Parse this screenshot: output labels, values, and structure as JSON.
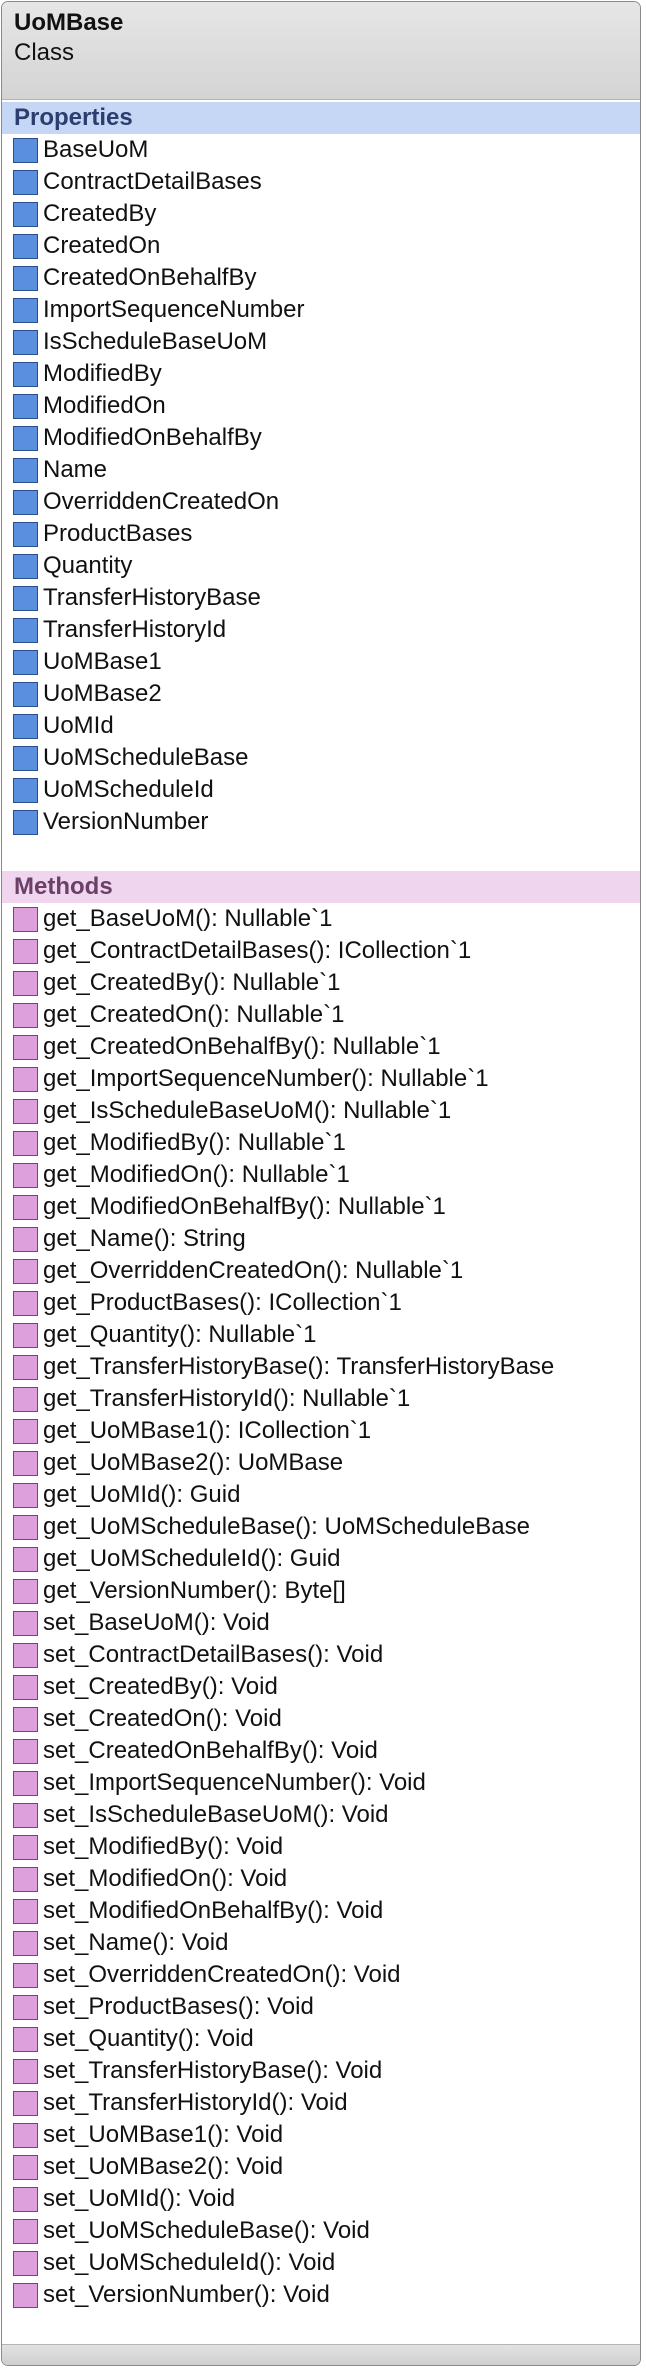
{
  "class": {
    "name": "UoMBase",
    "stereotype": "Class"
  },
  "properties": {
    "title": "Properties",
    "items": [
      "BaseUoM",
      "ContractDetailBases",
      "CreatedBy",
      "CreatedOn",
      "CreatedOnBehalfBy",
      "ImportSequenceNumber",
      "IsScheduleBaseUoM",
      "ModifiedBy",
      "ModifiedOn",
      "ModifiedOnBehalfBy",
      "Name",
      "OverriddenCreatedOn",
      "ProductBases",
      "Quantity",
      "TransferHistoryBase",
      "TransferHistoryId",
      "UoMBase1",
      "UoMBase2",
      "UoMId",
      "UoMScheduleBase",
      "UoMScheduleId",
      "VersionNumber"
    ]
  },
  "methods": {
    "title": "Methods",
    "items": [
      "get_BaseUoM(): Nullable`1",
      "get_ContractDetailBases(): ICollection`1",
      "get_CreatedBy(): Nullable`1",
      "get_CreatedOn(): Nullable`1",
      "get_CreatedOnBehalfBy(): Nullable`1",
      "get_ImportSequenceNumber(): Nullable`1",
      "get_IsScheduleBaseUoM(): Nullable`1",
      "get_ModifiedBy(): Nullable`1",
      "get_ModifiedOn(): Nullable`1",
      "get_ModifiedOnBehalfBy(): Nullable`1",
      "get_Name(): String",
      "get_OverriddenCreatedOn(): Nullable`1",
      "get_ProductBases(): ICollection`1",
      "get_Quantity(): Nullable`1",
      "get_TransferHistoryBase(): TransferHistoryBase",
      "get_TransferHistoryId(): Nullable`1",
      "get_UoMBase1(): ICollection`1",
      "get_UoMBase2(): UoMBase",
      "get_UoMId(): Guid",
      "get_UoMScheduleBase(): UoMScheduleBase",
      "get_UoMScheduleId(): Guid",
      "get_VersionNumber(): Byte[]",
      "set_BaseUoM(): Void",
      "set_ContractDetailBases(): Void",
      "set_CreatedBy(): Void",
      "set_CreatedOn(): Void",
      "set_CreatedOnBehalfBy(): Void",
      "set_ImportSequenceNumber(): Void",
      "set_IsScheduleBaseUoM(): Void",
      "set_ModifiedBy(): Void",
      "set_ModifiedOn(): Void",
      "set_ModifiedOnBehalfBy(): Void",
      "set_Name(): Void",
      "set_OverriddenCreatedOn(): Void",
      "set_ProductBases(): Void",
      "set_Quantity(): Void",
      "set_TransferHistoryBase(): Void",
      "set_TransferHistoryId(): Void",
      "set_UoMBase1(): Void",
      "set_UoMBase2(): Void",
      "set_UoMId(): Void",
      "set_UoMScheduleBase(): Void",
      "set_UoMScheduleId(): Void",
      "set_VersionNumber(): Void"
    ]
  },
  "colors": {
    "property_icon": "#5a8fe0",
    "method_icon": "#dea0dc",
    "properties_band": "#c5d7f5",
    "methods_band": "#efd6ee"
  },
  "icons": {
    "property": "property-icon",
    "method": "method-icon"
  }
}
